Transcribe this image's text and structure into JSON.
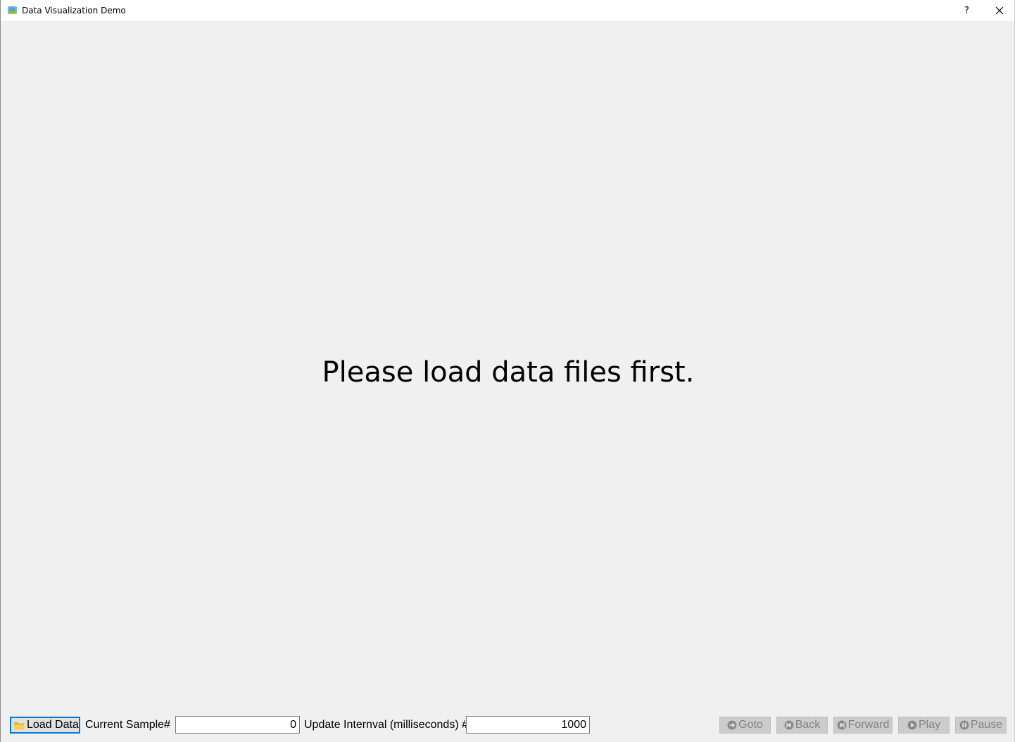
{
  "window": {
    "title": "Data Visualization Demo",
    "help_label": "?",
    "close_label": "✕"
  },
  "main": {
    "message": "Please load data files first."
  },
  "toolbar": {
    "load_label": "Load Data",
    "current_sample_label": "Current Sample#",
    "current_sample_value": "0",
    "interval_label": "Update Internval (milliseconds) #",
    "interval_value": "1000",
    "goto_label": "Goto",
    "back_label": "Back",
    "forward_label": "Forward",
    "play_label": "Play",
    "pause_label": "Pause"
  },
  "colors": {
    "background": "#f0f0f0",
    "focus_border": "#0078d7",
    "disabled_button": "#cccccc",
    "disabled_text": "#838383"
  }
}
